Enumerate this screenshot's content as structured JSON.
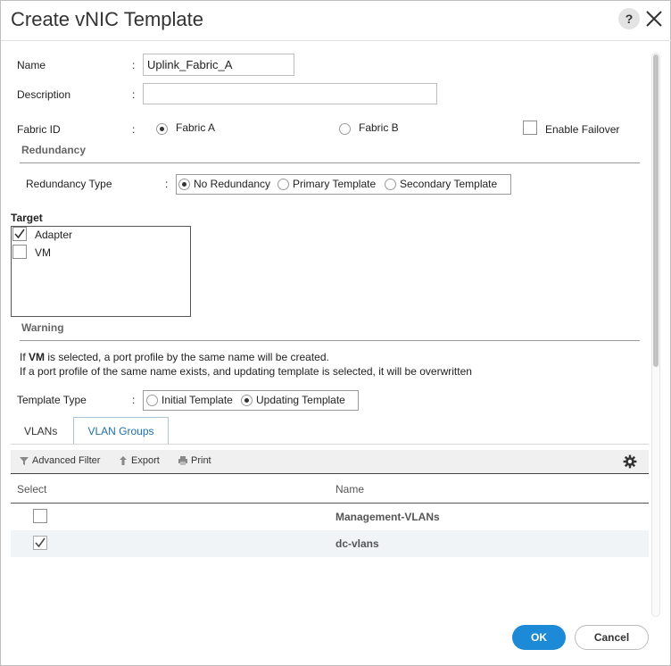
{
  "dialog": {
    "title": "Create vNIC Template",
    "help_label": "?"
  },
  "form": {
    "name_label": "Name",
    "name_value": "Uplink_Fabric_A",
    "description_label": "Description",
    "description_value": "",
    "colon": ":",
    "fabric_label": "Fabric ID",
    "fabric_options": [
      "Fabric A",
      "Fabric B"
    ],
    "fabric_selected": "Fabric A",
    "enable_failover_label": "Enable Failover",
    "enable_failover_checked": false
  },
  "redundancy": {
    "section_title": "Redundancy",
    "type_label": "Redundancy Type",
    "options": [
      "No Redundancy",
      "Primary Template",
      "Secondary Template"
    ],
    "selected": "No Redundancy"
  },
  "target": {
    "label": "Target",
    "items": [
      {
        "label": "Adapter",
        "checked": true
      },
      {
        "label": "VM",
        "checked": false
      }
    ]
  },
  "warning": {
    "section_title": "Warning",
    "line1_prefix": "If ",
    "line1_bold": "VM",
    "line1_suffix": " is selected, a port profile by the same name will be created.",
    "line2": "If a port profile of the same name exists, and updating template is selected, it will be overwritten"
  },
  "template_type": {
    "label": "Template Type",
    "options": [
      "Initial Template",
      "Updating Template"
    ],
    "selected": "Updating Template"
  },
  "tabs": [
    {
      "label": "VLANs",
      "active": false
    },
    {
      "label": "VLAN Groups",
      "active": true
    }
  ],
  "toolbar": {
    "advanced_filter": "Advanced Filter",
    "export": "Export",
    "print": "Print"
  },
  "grid": {
    "columns": [
      "Select",
      "Name"
    ],
    "rows": [
      {
        "name": "Management-VLANs",
        "checked": false
      },
      {
        "name": "dc-vlans",
        "checked": true
      }
    ]
  },
  "buttons": {
    "ok": "OK",
    "cancel": "Cancel"
  },
  "colors": {
    "accent": "#1c8ad6",
    "tab_active_text": "#1f6fa8"
  }
}
